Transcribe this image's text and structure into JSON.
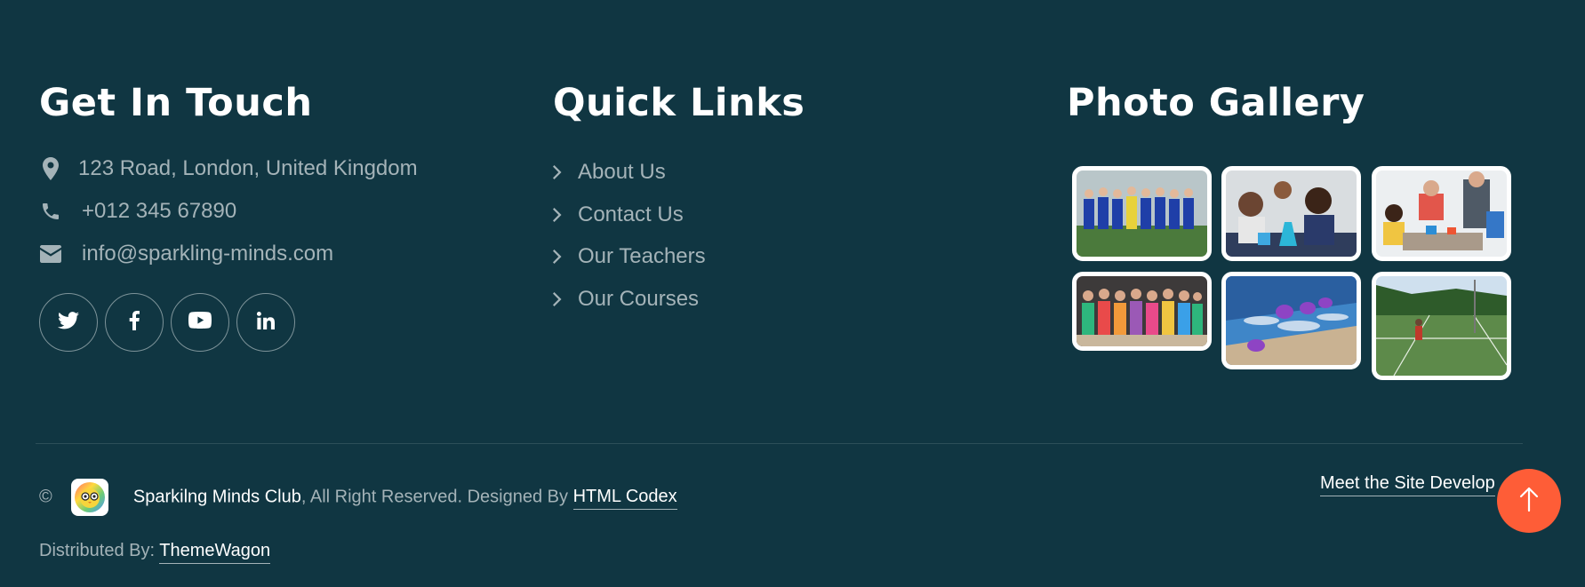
{
  "contact": {
    "title": "Get In Touch",
    "address": "123 Road, London, United Kingdom",
    "phone": "+012 345 67890",
    "email": "info@sparkling-minds.com",
    "socials": [
      {
        "name": "twitter",
        "icon": "twitter-icon"
      },
      {
        "name": "facebook",
        "icon": "facebook-icon"
      },
      {
        "name": "youtube",
        "icon": "youtube-icon"
      },
      {
        "name": "linkedin",
        "icon": "linkedin-icon"
      }
    ]
  },
  "quick_links": {
    "title": "Quick Links",
    "items": [
      "About Us",
      "Contact Us",
      "Our Teachers",
      "Our Courses"
    ]
  },
  "gallery": {
    "title": "Photo Gallery",
    "photos": [
      "football-team-photo",
      "science-experiment-photo",
      "robotics-class-photo",
      "kids-cheering-photo",
      "swimming-race-photo",
      "tennis-court-photo"
    ]
  },
  "footer": {
    "copyright_symbol": "©",
    "brand": "Sparkilng Minds Club",
    "rights_text": ", All Right Reserved. Designed By",
    "designer": "HTML Codex",
    "distributed_label": "Distributed By:",
    "distributor": "ThemeWagon",
    "developer_link": "Meet the Site Develop"
  },
  "colors": {
    "background": "#103642",
    "muted_text": "#a4b3b8",
    "accent": "#fe5d37"
  }
}
